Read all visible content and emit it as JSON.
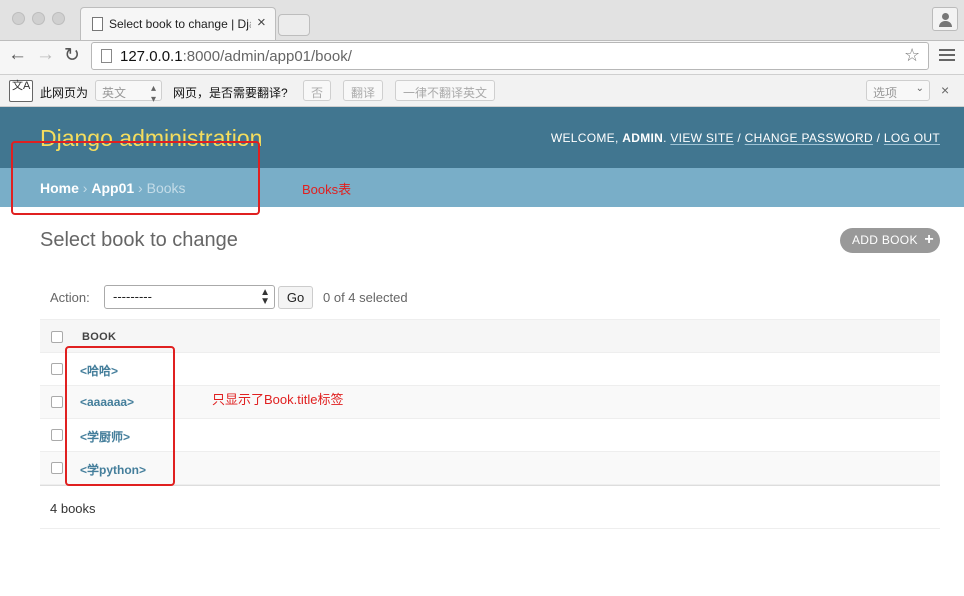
{
  "browser": {
    "tab": {
      "title": "Select book to change | Dj",
      "title_fade": "a",
      "close": "×"
    },
    "nav": {
      "back": "←",
      "forward": "→",
      "reload": "↻"
    },
    "address": {
      "host": "127.0.0.1",
      "rest": ":8000/admin/app01/book/"
    },
    "star": "☆"
  },
  "translate_bar": {
    "icon_text": "文A",
    "prefix": "此网页为",
    "language": "英文",
    "question": "网页，是否需要翻译?",
    "no_button": "否",
    "translate_button": "翻译",
    "never_button": "一律不翻译英文",
    "options": "选项",
    "close": "×"
  },
  "admin": {
    "branding": "Django administration",
    "user_tools": {
      "welcome": "WELCOME,",
      "username": "ADMIN",
      "view_site": "VIEW SITE",
      "change_password": "CHANGE PASSWORD",
      "log_out": "LOG OUT",
      "sep": "/"
    },
    "breadcrumbs": {
      "home": "Home",
      "app": "App01",
      "model": "Books",
      "sep": "›"
    },
    "title": "Select book to change",
    "add_button": "ADD BOOK",
    "add_plus": "+",
    "actions": {
      "label": "Action:",
      "selected_option": "---------",
      "go": "Go",
      "count": "0 of 4 selected"
    },
    "table": {
      "column": "BOOK",
      "rows": [
        {
          "label": "<哈哈>"
        },
        {
          "label": "<aaaaaa>"
        },
        {
          "label": "<学厨师>"
        },
        {
          "label": "<学python>"
        }
      ]
    },
    "paginator": "4 books"
  },
  "annotations": {
    "breadcrumb_note": "Books表",
    "rows_note": "只显示了Book.title标签",
    "color": "#e02020"
  }
}
